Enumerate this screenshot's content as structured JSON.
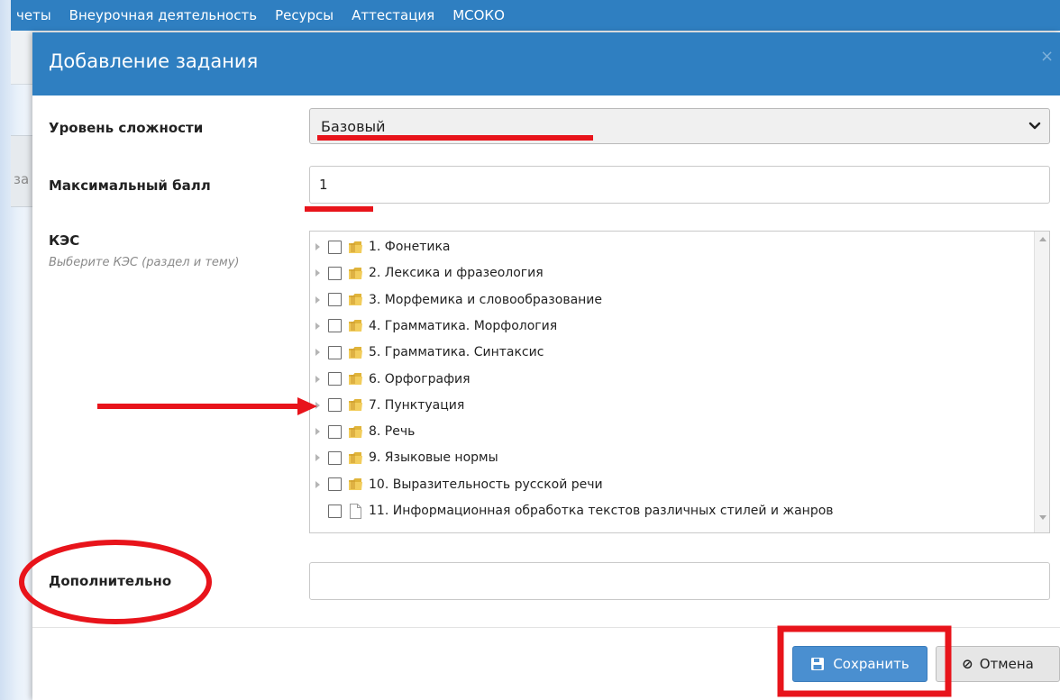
{
  "topnav": {
    "items": [
      "четы",
      "Внеурочная деятельность",
      "Ресурсы",
      "Аттестация",
      "МСОКО"
    ]
  },
  "background": {
    "fragment": "за"
  },
  "modal": {
    "title": "Добавление задания",
    "close_glyph": "×",
    "difficulty": {
      "label": "Уровень сложности",
      "value": "Базовый"
    },
    "max_score": {
      "label": "Максимальный балл",
      "value": "1"
    },
    "kes": {
      "label": "КЭС",
      "hint": "Выберите КЭС (раздел и тему)",
      "items": [
        {
          "label": "1. Фонетика",
          "icon": "folder-icon",
          "expandable": true
        },
        {
          "label": "2. Лексика и фразеология",
          "icon": "folder-icon",
          "expandable": true
        },
        {
          "label": "3. Морфемика и словообразование",
          "icon": "folder-icon",
          "expandable": true
        },
        {
          "label": "4. Грамматика. Морфология",
          "icon": "folder-icon",
          "expandable": true
        },
        {
          "label": "5. Грамматика. Синтаксис",
          "icon": "folder-icon",
          "expandable": true
        },
        {
          "label": "6. Орфография",
          "icon": "folder-icon",
          "expandable": true
        },
        {
          "label": "7. Пунктуация",
          "icon": "folder-icon",
          "expandable": true
        },
        {
          "label": "8. Речь",
          "icon": "folder-icon",
          "expandable": true
        },
        {
          "label": "9. Языковые нормы",
          "icon": "folder-icon",
          "expandable": true
        },
        {
          "label": "10. Выразительность русской речи",
          "icon": "folder-icon",
          "expandable": true
        },
        {
          "label": "11. Информационная обработка текстов различных стилей и жанров",
          "icon": "document-icon",
          "expandable": false
        }
      ]
    },
    "extra": {
      "label": "Дополнительно",
      "value": ""
    },
    "buttons": {
      "save": "Сохранить",
      "cancel": "Отмена"
    }
  },
  "colors": {
    "header": "#2f7fc1",
    "save_button": "#4a8fd0",
    "annotation": "#e8141b"
  }
}
